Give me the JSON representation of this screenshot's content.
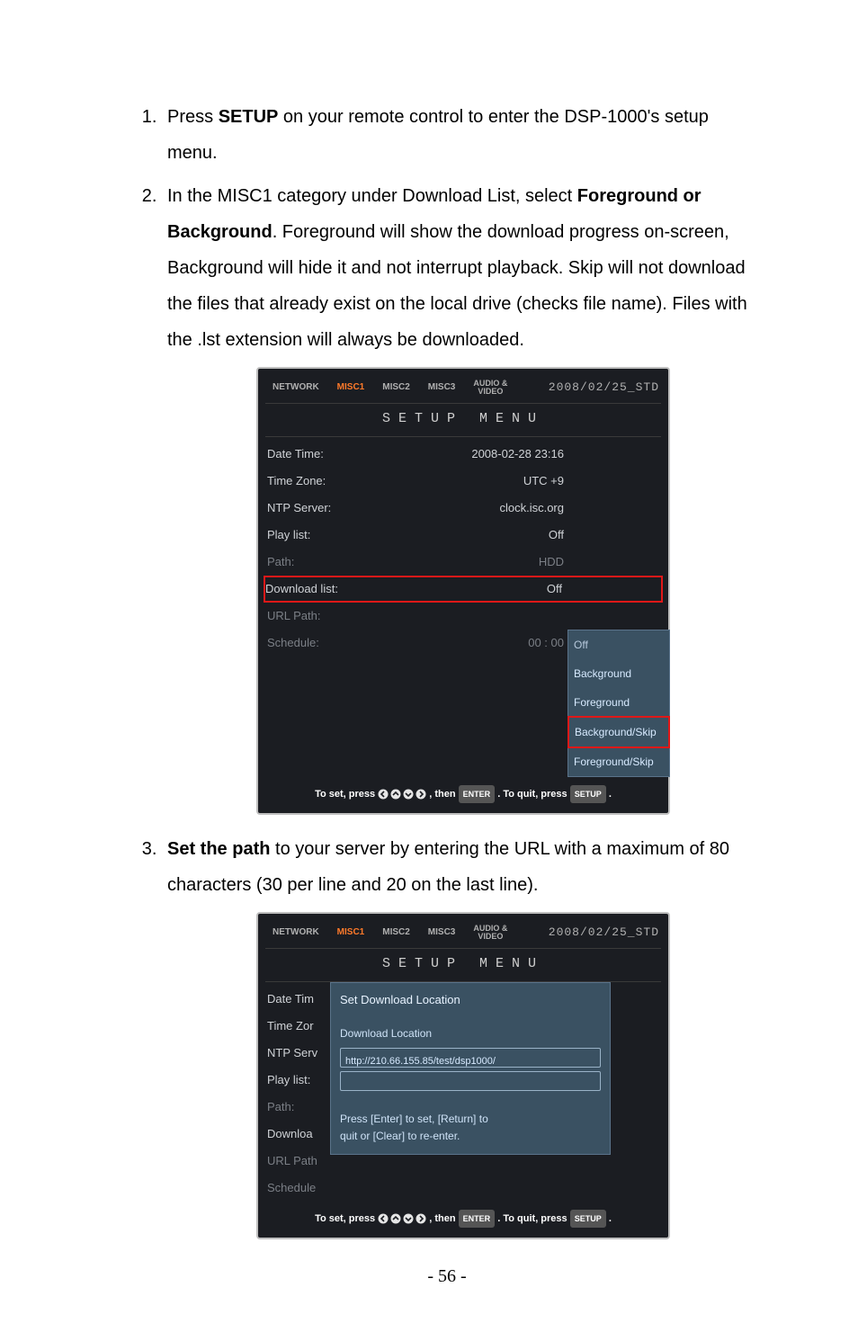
{
  "list": {
    "item1_a": "Press ",
    "item1_b": "SETUP",
    "item1_c": " on your remote control to enter the DSP-1000's setup menu.",
    "item2_a": "In the MISC1 category under Download List, select ",
    "item2_b": "Foreground or Background",
    "item2_c": ". Foreground will show the download progress on-screen, Background will hide it and not interrupt playback. Skip will not download the files that already exist on the local drive (checks file name). Files with the .lst extension will always be downloaded.",
    "item3_a": "Set the path",
    "item3_b": " to your server by entering the URL with a maximum of 80 characters (30 per line and 20 on the last line)."
  },
  "shot_common": {
    "tabs": {
      "network": "NETWORK",
      "misc1": "MISC1",
      "misc2": "MISC2",
      "misc3": "MISC3",
      "audio_line1": "AUDIO &",
      "audio_line2": "VIDEO"
    },
    "date_stamp": "2008/02/25_STD",
    "setup_title": "SETUP MENU",
    "hint_prefix": "To set, press ",
    "hint_then": ", then ",
    "hint_enter": "ENTER",
    "hint_mid": " . To quit, press ",
    "hint_setup": "SETUP",
    "hint_end": " ."
  },
  "shot1": {
    "rows": {
      "date_time_label": "Date Time:",
      "date_time_value": "2008-02-28 23:16",
      "time_zone_label": "Time Zone:",
      "time_zone_value": "UTC +9",
      "ntp_label": "NTP Server:",
      "ntp_value": "clock.isc.org",
      "play_list_label": "Play list:",
      "play_list_value": "Off",
      "path_label": "Path:",
      "path_value": "HDD",
      "download_label": "Download list:",
      "download_value": "Off",
      "url_label": "URL Path:",
      "url_value": "",
      "schedule_label": "Schedule:",
      "schedule_value": "00 : 00"
    },
    "dropdown": {
      "off": "Off",
      "background": "Background",
      "foreground": "Foreground",
      "background_skip": "Background/Skip",
      "foreground_skip": "Foreground/Skip"
    }
  },
  "shot2": {
    "base_labels": {
      "date_time": "Date Tim",
      "time_zone": "Time Zor",
      "ntp": "NTP Serv",
      "play_list": "Play list:",
      "path": "Path:",
      "download": "Downloa",
      "url": "URL Path",
      "schedule": "Schedule"
    },
    "dialog": {
      "title": "Set Download Location",
      "sub": "Download Location",
      "line1": "http://210.66.155.85/test/dsp1000/",
      "instr1": "Press [Enter] to set, [Return] to",
      "instr2": "quit or [Clear] to re-enter."
    }
  },
  "page_number": "- 56 -"
}
